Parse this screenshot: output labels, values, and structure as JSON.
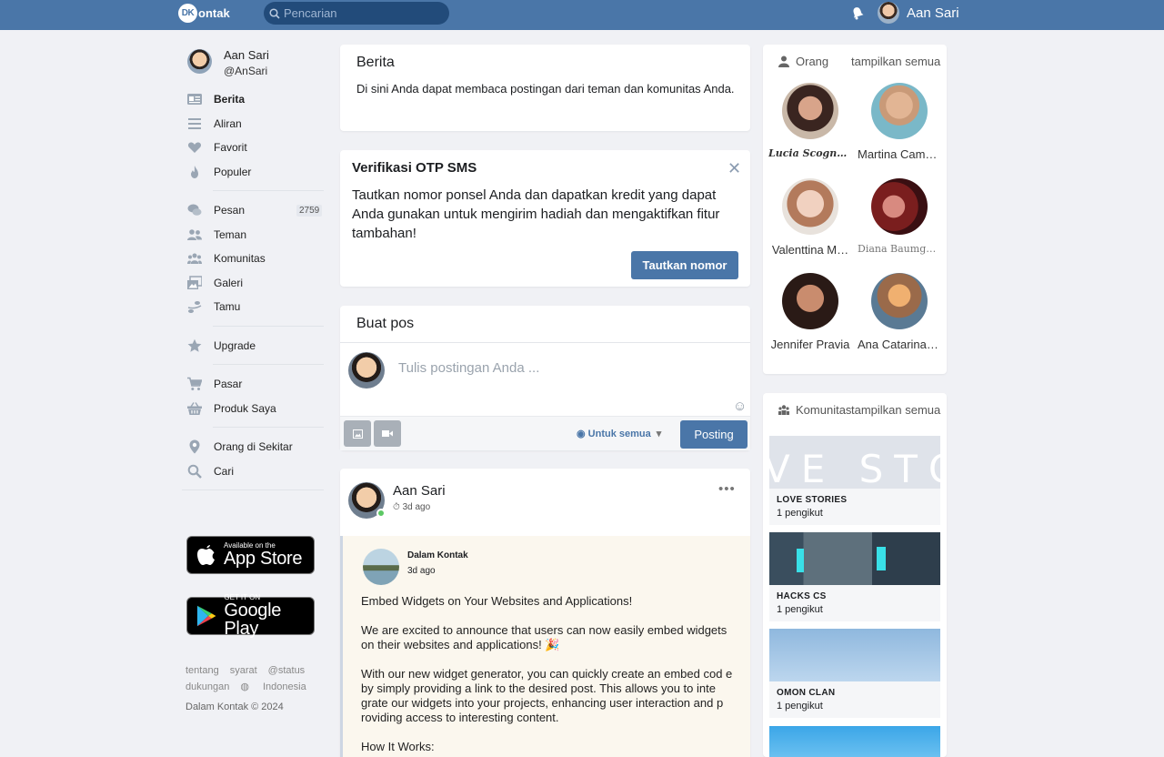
{
  "header": {
    "logo_mark": "DK",
    "logo_text": "ontak",
    "search_placeholder": "Pencarian",
    "user_name": "Aan Sari"
  },
  "sidebar": {
    "user": {
      "name": "Aan Sari",
      "handle": "@AnSari"
    },
    "groups": [
      [
        {
          "label": "Berita",
          "icon": "news-icon",
          "active": true
        },
        {
          "label": "Aliran",
          "icon": "stream-icon"
        },
        {
          "label": "Favorit",
          "icon": "heart-icon"
        },
        {
          "label": "Populer",
          "icon": "fire-icon"
        }
      ],
      [
        {
          "label": "Pesan",
          "icon": "chat-icon",
          "count": "2759"
        },
        {
          "label": "Teman",
          "icon": "friends-icon"
        },
        {
          "label": "Komunitas",
          "icon": "community-icon"
        },
        {
          "label": "Galeri",
          "icon": "gallery-icon"
        },
        {
          "label": "Tamu",
          "icon": "guests-icon"
        }
      ],
      [
        {
          "label": "Upgrade",
          "icon": "star-icon"
        }
      ],
      [
        {
          "label": "Pasar",
          "icon": "cart-icon"
        },
        {
          "label": "Produk Saya",
          "icon": "basket-icon"
        }
      ],
      [
        {
          "label": "Orang di Sekitar",
          "icon": "location-icon"
        },
        {
          "label": "Cari",
          "icon": "search-icon"
        }
      ]
    ],
    "appstore": {
      "small": "Available on the",
      "big": "App Store"
    },
    "googleplay": {
      "small": "GET IT ON",
      "big": "Google Play"
    },
    "footer": {
      "links": [
        "tentang",
        "syarat",
        "@status"
      ],
      "support": "dukungan",
      "language": "Indonesia",
      "copyright": "Dalam Kontak © 2024"
    }
  },
  "berita": {
    "title": "Berita",
    "description": "Di sini Anda dapat membaca postingan dari teman dan komunitas Anda."
  },
  "otp": {
    "title": "Verifikasi OTP SMS",
    "close": "✕",
    "text": "Tautkan nomor ponsel Anda dan dapatkan kredit yang dapat Anda gunakan untuk mengirim hadiah dan mengaktifkan fitur tambahan!",
    "button": "Tautkan nomor"
  },
  "composer": {
    "title": "Buat pos",
    "placeholder": "Tulis postingan Anda ...",
    "audience": "Untuk semua",
    "post_button": "Posting"
  },
  "post": {
    "author": "Aan Sari",
    "time": "3d ago",
    "shared": {
      "author": "Dalam Kontak",
      "time": "3d ago",
      "paragraphs": [
        "Embed Widgets on Your Websites and Applications!",
        "We are excited to announce that users can now easily embed widgets on their websites and applications! 🎉",
        "With our new widget generator, you can quickly create an embed cod e by simply providing a link to the desired post. This allows you to inte grate our widgets into your projects, enhancing user interaction and p roviding access to interesting content.",
        "How It Works:"
      ]
    }
  },
  "people": {
    "title": "Orang",
    "view_all": "tampilkan semua",
    "items": [
      {
        "name": "Lucia Scognamiglio",
        "style": "serif"
      },
      {
        "name": "Martina Camp…",
        "style": ""
      },
      {
        "name": "Valenttina M…",
        "style": ""
      },
      {
        "name": "Diana Baumgart…",
        "style": "mono"
      },
      {
        "name": "Jennifer Pravia",
        "style": ""
      },
      {
        "name": "Ana Catarina …",
        "style": ""
      }
    ]
  },
  "communities": {
    "title": "Komunitas",
    "view_all": "tampilkan semua",
    "items": [
      {
        "name": "LOVE STORIES",
        "followers": "1 pengikut",
        "banner": "VE STOR"
      },
      {
        "name": "HACKS CS",
        "followers": "1 pengikut",
        "banner": ""
      },
      {
        "name": "OMON CLAN",
        "followers": "1 pengikut",
        "banner": ""
      }
    ]
  },
  "colors": {
    "brand": "#4a76a8",
    "online": "#5cc864"
  }
}
